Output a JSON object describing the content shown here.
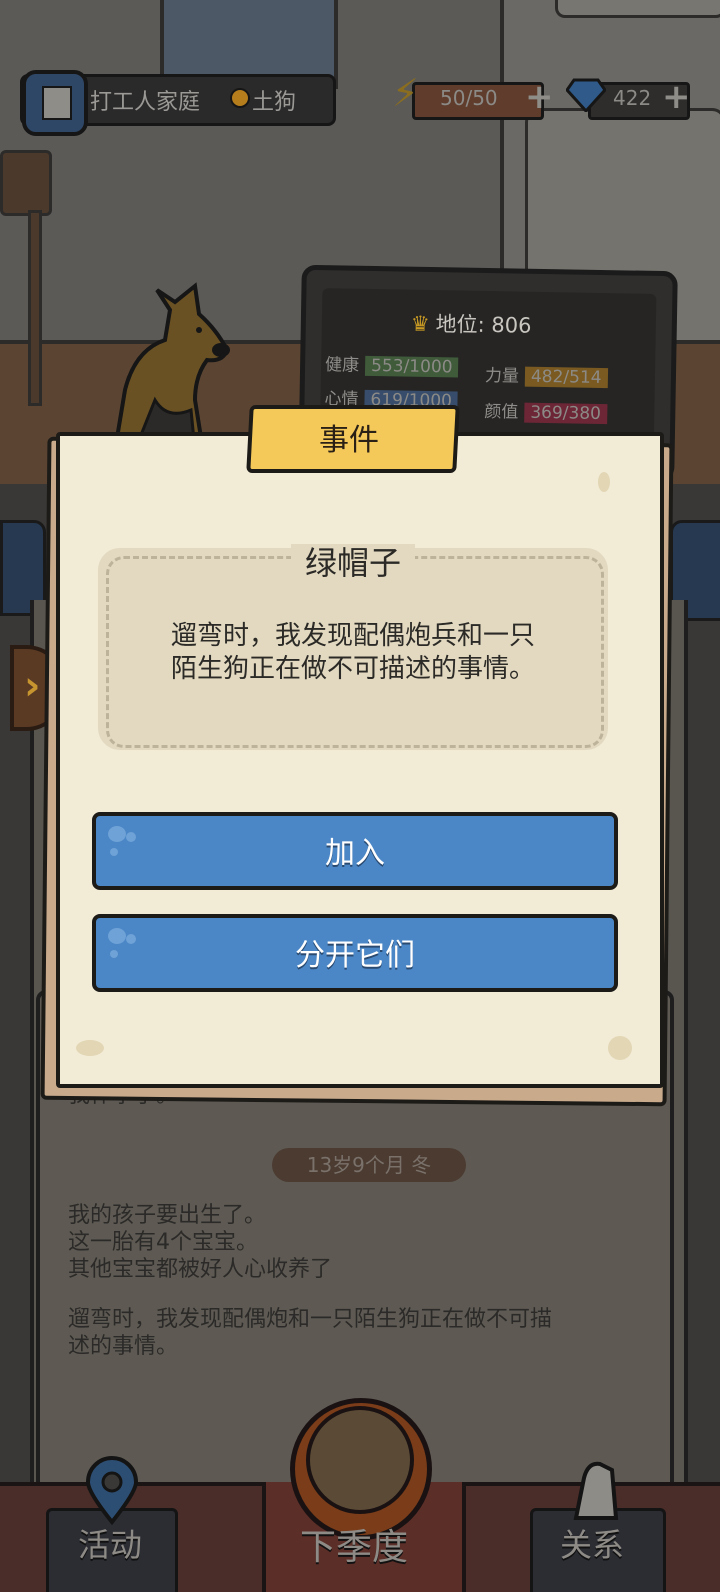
{
  "header": {
    "family_name": "打工人家庭",
    "breed": "土狗",
    "energy": "50/50",
    "gems": "422"
  },
  "stats_board": {
    "status_label": "地位: 806",
    "rows": [
      {
        "label": "健康",
        "value": "553/1000"
      },
      {
        "label": "力量",
        "value": "482/514"
      },
      {
        "label": "心情",
        "value": "619/1000"
      },
      {
        "label": "颜值",
        "value": "369/380"
      }
    ]
  },
  "dialog": {
    "tag": "事件",
    "title": "绿帽子",
    "description_line1": "遛弯时，我发现配偶炮兵和一只",
    "description_line2": "陌生狗正在做不可描述的事情。",
    "choices": [
      {
        "label": "加入"
      },
      {
        "label": "分开它们"
      }
    ]
  },
  "log": {
    "entry_top": "我怀孕了。",
    "age": "13岁9个月 冬",
    "lines": [
      "我的孩子要出生了。",
      "这一胎有4个宝宝。",
      "其他宝宝都被好人心收养了"
    ],
    "event_line1": "遛弯时，我发现配偶炮和一只陌生狗正在做不可描",
    "event_line2": "述的事情。"
  },
  "nav": {
    "activity": "活动",
    "next_season": "下季度",
    "relations": "关系"
  },
  "icons": {
    "family": "building-icon",
    "medal": "medal-icon",
    "energy": "lightning-icon",
    "gem": "diamond-icon",
    "crown": "crown-icon",
    "activity": "map-pin-icon",
    "next_season": "paw-icon",
    "relations": "handshake-icon"
  },
  "colors": {
    "choice_blue": "#4b87c6",
    "tag_yellow": "#f4c95a",
    "paper": "#f2ebd6"
  }
}
